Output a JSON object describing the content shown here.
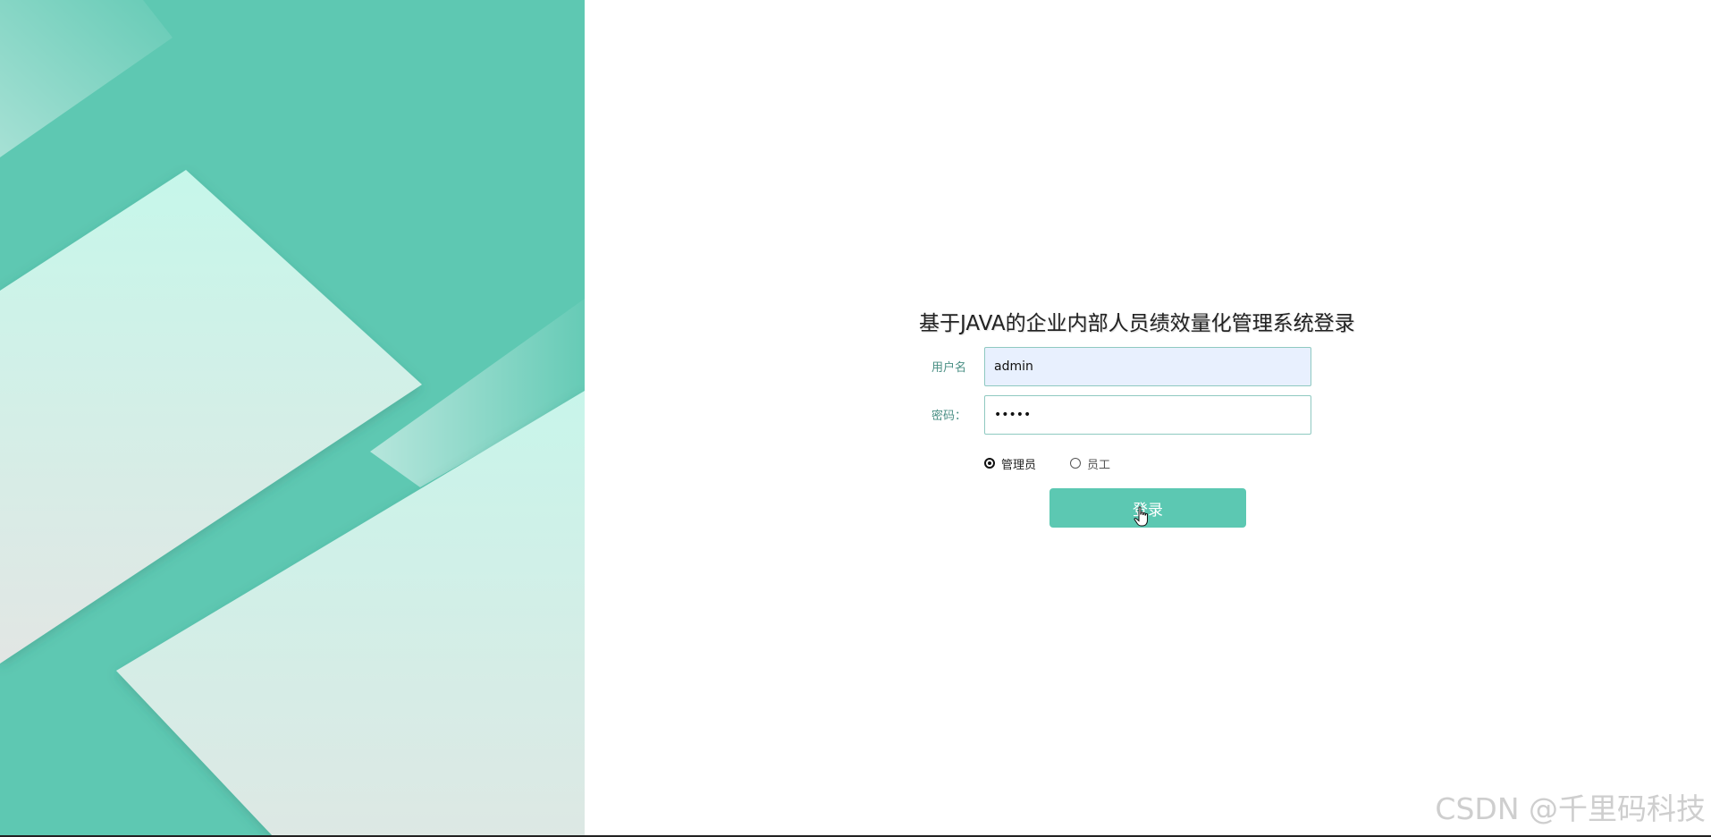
{
  "page": {
    "title": "基于JAVA的企业内部人员绩效量化管理系统登录",
    "watermark": "CSDN @千里码科技"
  },
  "form": {
    "username_label": "用户名",
    "username_value": "admin",
    "password_label": "密码：",
    "password_value": "•••••",
    "roles": [
      {
        "label": "管理员",
        "checked": true
      },
      {
        "label": "员工",
        "checked": false
      }
    ],
    "login_label": "登录"
  },
  "colors": {
    "accent": "#5cc8b2",
    "panel_bg": "#5ec8b2",
    "input_border": "#8fc9c1",
    "autofill_bg": "#e8f0fe"
  },
  "icons": {
    "cursor": "hand-pointer-icon"
  }
}
